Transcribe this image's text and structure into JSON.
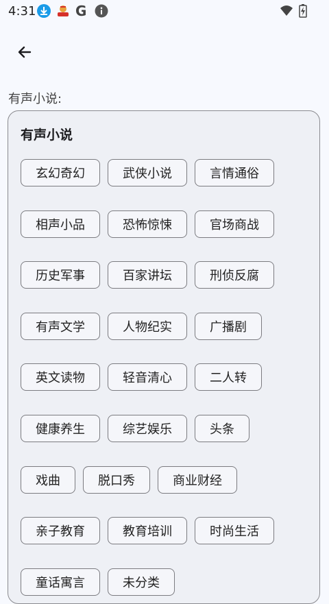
{
  "status": {
    "time": "4:31",
    "google_letter": "G"
  },
  "page": {
    "section_label": "有声小说:"
  },
  "card": {
    "title": "有声小说",
    "rows": [
      [
        "玄幻奇幻",
        "武侠小说",
        "言情通俗"
      ],
      [
        "相声小品",
        "恐怖惊悚",
        "官场商战"
      ],
      [
        "历史军事",
        "百家讲坛",
        "刑侦反腐"
      ],
      [
        "有声文学",
        "人物纪实",
        "广播剧"
      ],
      [
        "英文读物",
        "轻音清心",
        "二人转"
      ],
      [
        "健康养生",
        "综艺娱乐",
        "头条"
      ],
      [
        "戏曲",
        "脱口秀",
        "商业财经"
      ],
      [
        "亲子教育",
        "教育培训",
        "时尚生活"
      ],
      [
        "童话寓言",
        "未分类"
      ]
    ]
  },
  "colors": {
    "background": "#f7f9fe",
    "card_background": "#eef0f5",
    "chip_border": "#7b7b80"
  },
  "icons": [
    "download-icon",
    "app-notification-icon",
    "google-icon",
    "info-icon",
    "wifi-icon",
    "battery-charging-icon",
    "back-arrow-icon"
  ]
}
